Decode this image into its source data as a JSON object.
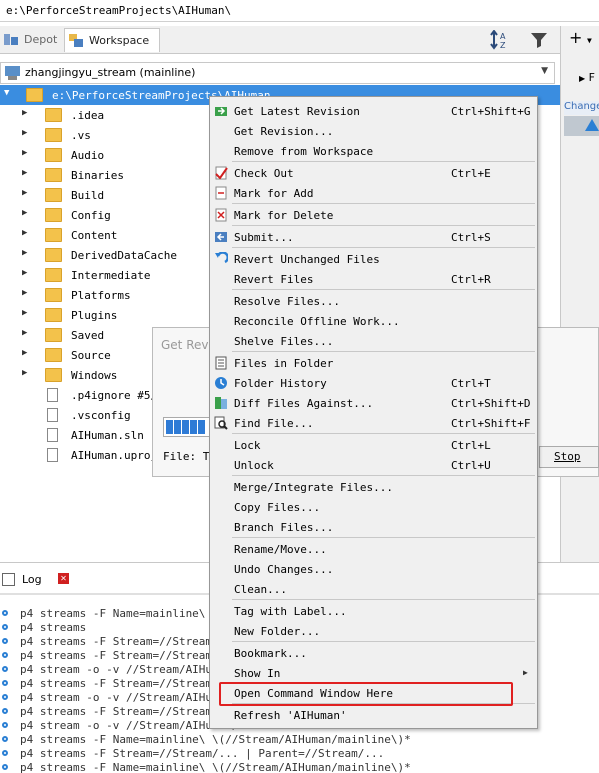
{
  "path_bar": {
    "text": "e:\\PerforceStreamProjects\\AIHuman\\"
  },
  "tabs": [
    {
      "label": "Depot",
      "active": false
    },
    {
      "label": "Workspace",
      "active": true
    }
  ],
  "right_panel": {
    "f_label": "F",
    "change_label": "Change"
  },
  "stream": {
    "label": "zhangjingyu_stream (mainline)"
  },
  "tree": {
    "root": "e:\\PerforceStreamProjects\\AIHuman",
    "items": [
      {
        "label": ".idea",
        "type": "folder"
      },
      {
        "label": ".vs",
        "type": "folder"
      },
      {
        "label": "Audio",
        "type": "folder"
      },
      {
        "label": "Binaries",
        "type": "folder"
      },
      {
        "label": "Build",
        "type": "folder"
      },
      {
        "label": "Config",
        "type": "folder"
      },
      {
        "label": "Content",
        "type": "folder"
      },
      {
        "label": "DerivedDataCache",
        "type": "folder"
      },
      {
        "label": "Intermediate",
        "type": "folder"
      },
      {
        "label": "Platforms",
        "type": "folder"
      },
      {
        "label": "Plugins",
        "type": "folder"
      },
      {
        "label": "Saved",
        "type": "folder"
      },
      {
        "label": "Source",
        "type": "folder"
      },
      {
        "label": "Windows",
        "type": "folder"
      },
      {
        "label": ".p4ignore #5/5",
        "type": "file"
      },
      {
        "label": ".vsconfig",
        "type": "file"
      },
      {
        "label": "AIHuman.sln",
        "type": "file"
      },
      {
        "label": "AIHuman.uproject",
        "type": "file"
      }
    ]
  },
  "dialog": {
    "title": "Get Revision",
    "file_label": "File: T_",
    "stop_label": "Stop",
    "progress_blocks": 5
  },
  "log": {
    "tab_label": "Log",
    "lines": [
      "p4 streams -F Name=mainline\\ \\(//Stream/AIHuman/mainline\\)*",
      "p4 streams",
      "p4 streams -F Stream=//Stream/...",
      "p4 streams -F Stream=//Stream/...",
      "p4 stream -o -v //Stream/AIHuman/mainline",
      "p4 streams -F Stream=//Stream/...",
      "p4 stream -o -v //Stream/AIHuman/mainline",
      "p4 streams -F Stream=//Stream/...",
      "p4 stream -o -v //Stream/AIHuman/mainline",
      "p4 streams -F Name=mainline\\ \\(//Stream/AIHuman/mainline\\)*",
      "p4 streams -F Stream=//Stream/... | Parent=//Stream/...",
      "p4 streams -F Name=mainline\\ \\(//Stream/AIHuman/mainline\\)*"
    ]
  },
  "menu": {
    "items": [
      {
        "label": "Get Latest Revision",
        "shortcut": "Ctrl+Shift+G",
        "icon": "get-latest-icon"
      },
      {
        "label": "Get Revision...",
        "shortcut": "",
        "icon": ""
      },
      {
        "label": "Remove from Workspace",
        "shortcut": "",
        "icon": ""
      },
      {
        "label": "Check Out",
        "shortcut": "Ctrl+E",
        "icon": "check-out-icon"
      },
      {
        "label": "Mark for Add",
        "shortcut": "",
        "icon": "mark-add-icon"
      },
      {
        "label": "Mark for Delete",
        "shortcut": "",
        "icon": "mark-delete-icon"
      },
      {
        "label": "Submit...",
        "shortcut": "Ctrl+S",
        "icon": "submit-icon"
      },
      {
        "label": "Revert Unchanged Files",
        "shortcut": "",
        "icon": "revert-icon"
      },
      {
        "label": "Revert Files",
        "shortcut": "Ctrl+R",
        "icon": ""
      },
      {
        "label": "Resolve Files...",
        "shortcut": "",
        "icon": ""
      },
      {
        "label": "Reconcile Offline Work...",
        "shortcut": "",
        "icon": ""
      },
      {
        "label": "Shelve Files...",
        "shortcut": "",
        "icon": ""
      },
      {
        "label": "Files in Folder",
        "shortcut": "",
        "icon": "files-in-folder-icon"
      },
      {
        "label": "Folder History",
        "shortcut": "Ctrl+T",
        "icon": "history-icon"
      },
      {
        "label": "Diff Files Against...",
        "shortcut": "Ctrl+Shift+D",
        "icon": "diff-icon"
      },
      {
        "label": "Find File...",
        "shortcut": "Ctrl+Shift+F",
        "icon": "find-icon"
      },
      {
        "label": "Lock",
        "shortcut": "Ctrl+L",
        "icon": ""
      },
      {
        "label": "Unlock",
        "shortcut": "Ctrl+U",
        "icon": ""
      },
      {
        "label": "Merge/Integrate Files...",
        "shortcut": "",
        "icon": ""
      },
      {
        "label": "Copy Files...",
        "shortcut": "",
        "icon": ""
      },
      {
        "label": "Branch Files...",
        "shortcut": "",
        "icon": ""
      },
      {
        "label": "Rename/Move...",
        "shortcut": "",
        "icon": ""
      },
      {
        "label": "Undo Changes...",
        "shortcut": "",
        "icon": ""
      },
      {
        "label": "Clean...",
        "shortcut": "",
        "icon": ""
      },
      {
        "label": "Tag with Label...",
        "shortcut": "",
        "icon": ""
      },
      {
        "label": "New Folder...",
        "shortcut": "",
        "icon": ""
      },
      {
        "label": "Bookmark...",
        "shortcut": "",
        "icon": ""
      },
      {
        "label": "Show In",
        "shortcut": "",
        "icon": "",
        "submenu": true
      },
      {
        "label": "Open Command Window Here",
        "shortcut": "",
        "icon": "",
        "highlighted": true
      },
      {
        "label": "Refresh 'AIHuman'",
        "shortcut": "",
        "icon": ""
      }
    ]
  },
  "colors": {
    "selection": "#3a8de0",
    "highlight_border": "#e02020",
    "folder": "#f3c24b"
  }
}
